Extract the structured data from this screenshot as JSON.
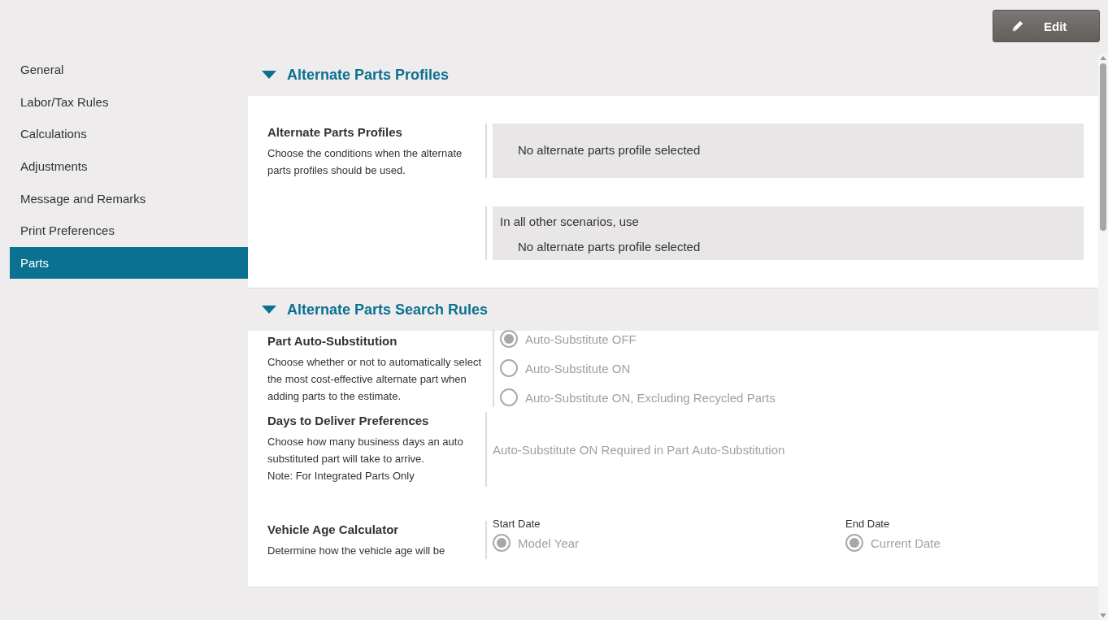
{
  "toolbar": {
    "edit_button": "Edit"
  },
  "sidebar": {
    "items": [
      {
        "label": "General",
        "selected": false
      },
      {
        "label": "Labor/Tax Rules",
        "selected": false
      },
      {
        "label": "Calculations",
        "selected": false
      },
      {
        "label": "Adjustments",
        "selected": false
      },
      {
        "label": "Message and Remarks",
        "selected": false
      },
      {
        "label": "Print Preferences",
        "selected": false
      },
      {
        "label": "Parts",
        "selected": true
      }
    ]
  },
  "sections": [
    {
      "title": "Alternate Parts Profiles",
      "expanded": true,
      "rows": [
        {
          "kind": "panels",
          "title": "Alternate Parts Profiles",
          "description": [
            "Choose the conditions when the alternate parts profiles should be used."
          ],
          "panels": [
            {
              "value": "No alternate parts profile selected"
            },
            {
              "label": "In all other scenarios, use",
              "value": "No alternate parts profile selected"
            }
          ]
        }
      ]
    },
    {
      "title": "Alternate Parts Search Rules",
      "expanded": true,
      "rows": [
        {
          "kind": "radio",
          "title": "Part Auto-Substitution",
          "description": [
            "Choose whether or not to automatically select the most cost-effective alternate part when adding parts to the estimate."
          ],
          "options": [
            {
              "label": "Auto-Substitute OFF",
              "selected": true
            },
            {
              "label": "Auto-Substitute ON",
              "selected": false
            },
            {
              "label": "Auto-Substitute ON, Excluding Recycled Parts",
              "selected": false
            }
          ]
        },
        {
          "kind": "note",
          "title": "Days to Deliver Preferences",
          "description": [
            "Choose how many business days an auto substituted part will take to arrive.",
            "Note: For Integrated Parts Only"
          ],
          "note": "Auto-Substitute ON Required in Part Auto-Substitution"
        },
        {
          "kind": "columns",
          "title": "Vehicle Age Calculator",
          "description": [
            "Determine how the vehicle age will be"
          ],
          "columns": [
            {
              "label": "Start Date",
              "options": [
                {
                  "label": "Model Year",
                  "selected": true
                }
              ]
            },
            {
              "label": "End Date",
              "options": [
                {
                  "label": "Current Date",
                  "selected": true
                }
              ]
            }
          ]
        }
      ]
    }
  ]
}
